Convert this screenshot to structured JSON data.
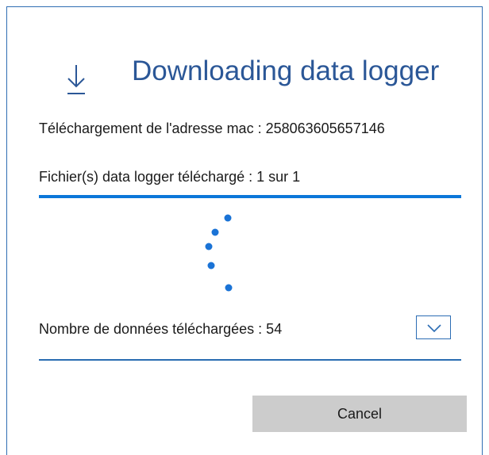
{
  "dialog": {
    "title": "Downloading data logger",
    "icon": "download-arrow-icon",
    "mac_address_label": "Téléchargement de l'adresse mac : 258063605657146",
    "files_downloaded_label": "Fichier(s) data logger téléchargé : 1 sur 1",
    "progress": 1.0,
    "data_count_label": "Nombre de données téléchargées : 54",
    "expand_icon": "chevron-down-icon",
    "cancel_label": "Cancel"
  },
  "colors": {
    "title": "#2b5797",
    "accent": "#0c77d9",
    "spinner": "#1a73d6",
    "border": "#2f6db3",
    "button_bg": "#cccccc"
  }
}
